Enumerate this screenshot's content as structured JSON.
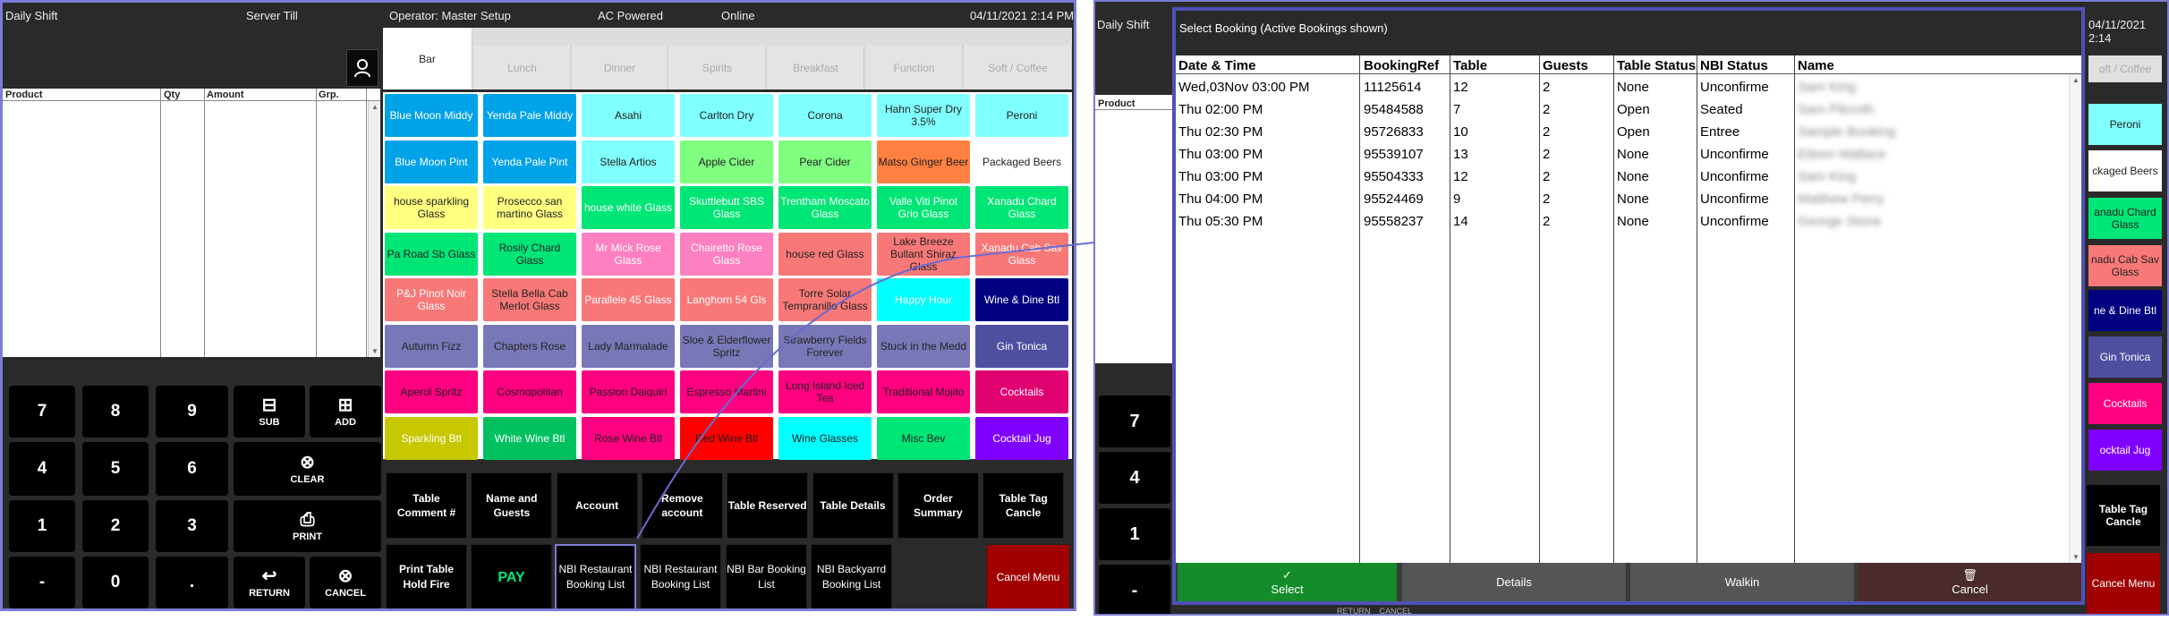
{
  "topbar": {
    "shift": "Daily Shift",
    "till": "Server Till",
    "operator": "Operator: Master Setup",
    "power": "AC Powered",
    "status": "Online",
    "datetime": "04/11/2021 2:14 PM"
  },
  "product_grid": {
    "columns": [
      "Product",
      "Qty",
      "Amount",
      "Grp."
    ]
  },
  "keypad": {
    "keys": [
      "7",
      "8",
      "9",
      "4",
      "5",
      "6",
      "1",
      "2",
      "3",
      "-",
      "0",
      "."
    ],
    "sub": "SUB",
    "add": "ADD",
    "clear": "CLEAR",
    "print": "PRINT",
    "return": "RETURN",
    "cancel": "CANCEL"
  },
  "tabs": [
    "Bar",
    "Lunch",
    "Dinner",
    "Spirits",
    "Breakfast",
    "Function",
    "Soft / Coffee"
  ],
  "items": [
    {
      "label": "Blue Moon Middy",
      "bg": "#00a2e8",
      "fg": "#fff"
    },
    {
      "label": "Yenda Pale Middy",
      "bg": "#00a2e8",
      "fg": "#fff"
    },
    {
      "label": "Asahi",
      "bg": "#80ffff",
      "fg": "#222"
    },
    {
      "label": "Carlton Dry",
      "bg": "#80ffff",
      "fg": "#222"
    },
    {
      "label": "Corona",
      "bg": "#80ffff",
      "fg": "#222"
    },
    {
      "label": "Hahn Super Dry 3.5%",
      "bg": "#80ffff",
      "fg": "#222"
    },
    {
      "label": "Peroni",
      "bg": "#80ffff",
      "fg": "#222"
    },
    {
      "label": "Blue Moon Pint",
      "bg": "#00a2e8",
      "fg": "#fff"
    },
    {
      "label": "Yenda Pale Pint",
      "bg": "#00a2e8",
      "fg": "#fff"
    },
    {
      "label": "Stella Artios",
      "bg": "#80ffff",
      "fg": "#222"
    },
    {
      "label": "Apple Cider",
      "bg": "#80ff80",
      "fg": "#222"
    },
    {
      "label": "Pear Cider",
      "bg": "#80ff80",
      "fg": "#222"
    },
    {
      "label": "Matso Ginger Beer",
      "bg": "#ff8040",
      "fg": "#222"
    },
    {
      "label": "Packaged Beers",
      "bg": "#fff",
      "fg": "#222"
    },
    {
      "label": "house sparkling Glass",
      "bg": "#ffff80",
      "fg": "#222"
    },
    {
      "label": "Prosecco san martino Glass",
      "bg": "#ffff80",
      "fg": "#222"
    },
    {
      "label": "house white Glass",
      "bg": "#00e676",
      "fg": "#fff"
    },
    {
      "label": "Skuttlebutt SBS Glass",
      "bg": "#00e676",
      "fg": "#fff"
    },
    {
      "label": "Trentham Moscato Glass",
      "bg": "#00e676",
      "fg": "#fff"
    },
    {
      "label": "Valle Viti Pinot Grio Glass",
      "bg": "#00e676",
      "fg": "#fff"
    },
    {
      "label": "Xanadu Chard Glass",
      "bg": "#00e676",
      "fg": "#fff"
    },
    {
      "label": "Pa Road Sb Glass",
      "bg": "#00e676",
      "fg": "#222"
    },
    {
      "label": "Rosily Chard Glass",
      "bg": "#00e676",
      "fg": "#222"
    },
    {
      "label": "Mr Mick Rose Glass",
      "bg": "#ff80c0",
      "fg": "#fff"
    },
    {
      "label": "Chairetto Rose Glass",
      "bg": "#ff80c0",
      "fg": "#fff"
    },
    {
      "label": "house red Glass",
      "bg": "#f87878",
      "fg": "#222"
    },
    {
      "label": "Lake Breeze Bullant Shiraz Glass",
      "bg": "#f87878",
      "fg": "#222"
    },
    {
      "label": "Xanadu Cab Sav Glass",
      "bg": "#f87878",
      "fg": "#fff"
    },
    {
      "label": "P&J Pinot Noir Glass",
      "bg": "#f87878",
      "fg": "#fff"
    },
    {
      "label": "Stella Bella Cab Merlot Glass",
      "bg": "#f87878",
      "fg": "#222"
    },
    {
      "label": "Parallele 45 Glass",
      "bg": "#f87878",
      "fg": "#fff"
    },
    {
      "label": "Langhorn 54 Gls",
      "bg": "#f87878",
      "fg": "#fff"
    },
    {
      "label": "Torre Solar Tempranillo Glass",
      "bg": "#f87878",
      "fg": "#222"
    },
    {
      "label": "Happy Hour",
      "bg": "#00ffff",
      "fg": "#fff"
    },
    {
      "label": "Wine & Dine Btl",
      "bg": "#000080",
      "fg": "#fff"
    },
    {
      "label": "Autumn Fizz",
      "bg": "#7878b8",
      "fg": "#222"
    },
    {
      "label": "Chapters Rose",
      "bg": "#7878b8",
      "fg": "#222"
    },
    {
      "label": "Lady Marmalade",
      "bg": "#7878b8",
      "fg": "#222"
    },
    {
      "label": "Sloe & Elderflower Spritz",
      "bg": "#7878b8",
      "fg": "#222"
    },
    {
      "label": "Strawberry Fields Forever",
      "bg": "#7878b8",
      "fg": "#222"
    },
    {
      "label": "Stuck in the Medd",
      "bg": "#7878b8",
      "fg": "#222"
    },
    {
      "label": "Gin Tonica",
      "bg": "#4f4fa0",
      "fg": "#fff"
    },
    {
      "label": "Aperol Spritz",
      "bg": "#ff0080",
      "fg": "#222"
    },
    {
      "label": "Cosmopolitan",
      "bg": "#ff0080",
      "fg": "#222"
    },
    {
      "label": "Passion Daiquiri",
      "bg": "#ff0080",
      "fg": "#222"
    },
    {
      "label": "Espresso Martini",
      "bg": "#ff0080",
      "fg": "#222"
    },
    {
      "label": "Long Island Iced Tea",
      "bg": "#ff0080",
      "fg": "#222"
    },
    {
      "label": "Traditional Mojito",
      "bg": "#ff0080",
      "fg": "#222"
    },
    {
      "label": "Cocktails",
      "bg": "#e00070",
      "fg": "#fff"
    },
    {
      "label": "Sparkling Btl",
      "bg": "#c8c800",
      "fg": "#fff"
    },
    {
      "label": "White Wine Btl",
      "bg": "#00c060",
      "fg": "#fff"
    },
    {
      "label": "Rose Wine Btl",
      "bg": "#ff0080",
      "fg": "#222"
    },
    {
      "label": "Red Wine Btl",
      "bg": "#ff0000",
      "fg": "#222"
    },
    {
      "label": "Wine Glasses",
      "bg": "#00ffff",
      "fg": "#222"
    },
    {
      "label": "Misc Bev",
      "bg": "#00e676",
      "fg": "#222"
    },
    {
      "label": "Cocktail Jug",
      "bg": "#8000ff",
      "fg": "#fff"
    }
  ],
  "function_keys": [
    "Table Comment #",
    "Name and Guests",
    "Account",
    "Remove account",
    "Table Reserved",
    "Table Details",
    "Order Summary",
    "Table Tag Cancle"
  ],
  "bottom_keys": {
    "print_hold": "Print Table Hold Fire",
    "pay": "PAY",
    "nbi1": "NBI Restaurant Booking List",
    "nbi2": "NBI Restaurant Booking List",
    "nbi_bar": "NBI Bar Booking List",
    "nbi_back": "NBI Backyarrd Booking List",
    "cancel_menu": "Cancel Menu"
  },
  "right_panel": {
    "shift": "Daily Shift",
    "datetime": "04/11/2021 2:14",
    "product": "Product",
    "side_items": [
      "oft / Coffee",
      "Peroni",
      "ckaged Beers",
      "anadu Chard Glass",
      "nadu Cab Sav Glass",
      "ne & Dine Btl",
      "Gin Tonica",
      "Cocktails",
      "ocktail Jug"
    ],
    "keys": [
      "7",
      "4",
      "1",
      "-"
    ],
    "tag_cancel": "Table Tag Cancle",
    "cancel_menu": "Cancel Menu",
    "bottom_text": "RETURN    CANCEL"
  },
  "dialog": {
    "title": "Select Booking  (Active Bookings shown)",
    "columns": [
      "Date & Time",
      "BookingRef",
      "Table",
      "Guests",
      "Table Status",
      "NBI Status",
      "Name"
    ],
    "rows": [
      {
        "dt": "Wed,03Nov 03:00 PM",
        "ref": "11125614",
        "table": "12",
        "guests": "2",
        "tstatus": "None",
        "nbi": "Unconfirme",
        "name": "Sam King"
      },
      {
        "dt": "Thu 02:00 PM",
        "ref": "95484588",
        "table": "7",
        "guests": "2",
        "tstatus": "Open",
        "nbi": "Seated",
        "name": "Sam Pilcroth"
      },
      {
        "dt": "Thu 02:30 PM",
        "ref": "95726833",
        "table": "10",
        "guests": "2",
        "tstatus": "Open",
        "nbi": "Entree",
        "name": "Sample Booking"
      },
      {
        "dt": "Thu 03:00 PM",
        "ref": "95539107",
        "table": "13",
        "guests": "2",
        "tstatus": "None",
        "nbi": "Unconfirme",
        "name": "Eileen Wallace"
      },
      {
        "dt": "Thu 03:00 PM",
        "ref": "95504333",
        "table": "12",
        "guests": "2",
        "tstatus": "None",
        "nbi": "Unconfirme",
        "name": "Sam King"
      },
      {
        "dt": "Thu 04:00 PM",
        "ref": "95524469",
        "table": "9",
        "guests": "2",
        "tstatus": "None",
        "nbi": "Unconfirme",
        "name": "Matthew Perry"
      },
      {
        "dt": "Thu 05:30 PM",
        "ref": "95558237",
        "table": "14",
        "guests": "2",
        "tstatus": "None",
        "nbi": "Unconfirme",
        "name": "George Stone"
      }
    ],
    "buttons": {
      "select": "Select",
      "details": "Details",
      "walkin": "Walkin",
      "cancel": "Cancel"
    }
  }
}
